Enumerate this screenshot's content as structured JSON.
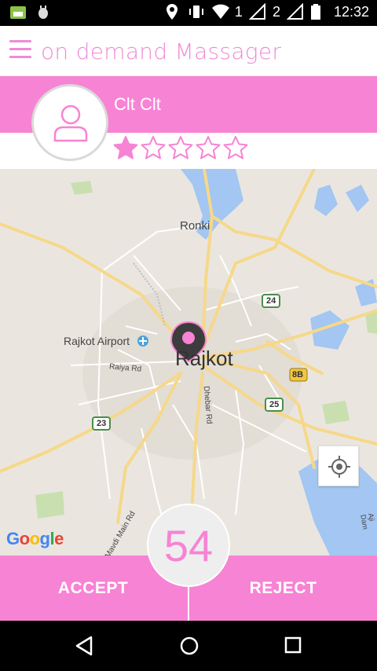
{
  "status_bar": {
    "time": "12:32",
    "sim1_label": "1",
    "sim2_label": "2"
  },
  "app_bar": {
    "title": "on demand Massager"
  },
  "profile": {
    "name": "Clt Clt",
    "rating": 1,
    "rating_max": 5
  },
  "map": {
    "labels": {
      "ronki": "Ronki",
      "rajkot": "Rajkot",
      "airport": "Rajkot Airport",
      "raiya_rd": "Raiya Rd",
      "dhebar_rd": "Dhebar Rd",
      "mavdi_main_rd": "Mavdi Main Rd",
      "aji_dam": "Aji Dam",
      "hw_24": "24",
      "hw_8b": "8B",
      "hw_25": "25",
      "hw_23": "23"
    },
    "google_logo": "Google"
  },
  "actions": {
    "accept_label": "ACCEPT",
    "reject_label": "REJECT",
    "timer": "54"
  },
  "colors": {
    "accent": "#f783d4",
    "title": "#ef8bd6",
    "map_bg": "#eae6df",
    "water": "#a3c6f2"
  }
}
